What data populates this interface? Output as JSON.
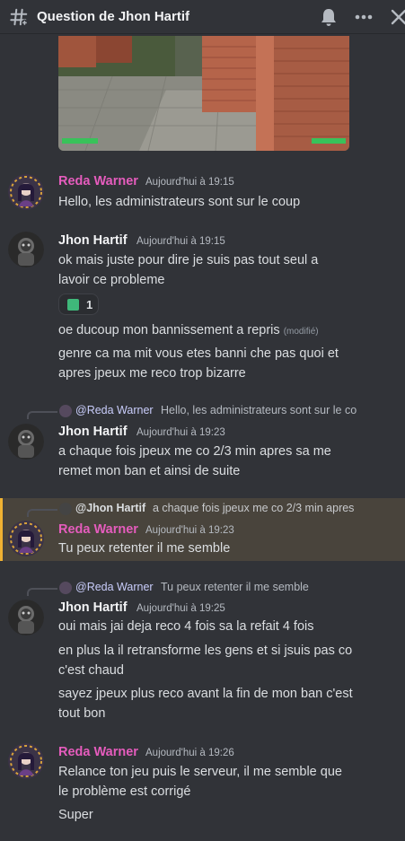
{
  "header": {
    "title": "Question de Jhon Hartif",
    "icons": [
      "hashtag-thread-icon",
      "bell-icon",
      "more-icon",
      "close-icon"
    ]
  },
  "messages": [
    {
      "author": "Reda Warner",
      "timestamp": "Aujourd'hui à 19:15",
      "lines": [
        "Hello, les administrateurs sont sur le coup"
      ]
    },
    {
      "author": "Jhon Hartif",
      "timestamp": "Aujourd'hui à 19:15",
      "lines": [
        "ok mais juste pour dire je suis pas tout seul a",
        "lavoir ce probleme"
      ],
      "reaction": {
        "count": "1"
      },
      "followups": [
        {
          "text": "oe ducoup mon bannissement a repris",
          "edited": "(modifié)"
        },
        {
          "text": "genre ca ma mit vous etes banni che pas quoi et"
        },
        {
          "text": "apres jpeux me reco trop bizarre"
        }
      ]
    },
    {
      "reply": {
        "mention": "@Reda Warner",
        "text": "Hello, les administrateurs sont sur le co"
      },
      "author": "Jhon Hartif",
      "timestamp": "Aujourd'hui à 19:23",
      "lines": [
        "a chaque fois jpeux me co 2/3 min apres sa me",
        "remet mon ban et ainsi de suite"
      ]
    },
    {
      "reply": {
        "mention": "@Jhon Hartif",
        "text": "a chaque fois jpeux me co 2/3 min apres"
      },
      "author": "Reda Warner",
      "timestamp": "Aujourd'hui à 19:23",
      "lines": [
        "Tu peux retenter il me semble"
      ]
    },
    {
      "reply": {
        "mention": "@Reda Warner",
        "text": "Tu peux retenter il me semble"
      },
      "author": "Jhon Hartif",
      "timestamp": "Aujourd'hui à 19:25",
      "lines": [
        "oui mais jai deja reco 4 fois sa la refait 4 fois",
        "en plus la il retransforme les gens et si jsuis pas co",
        "c'est chaud",
        "sayez jpeux plus reco avant la fin de mon ban c'est",
        "tout bon"
      ]
    },
    {
      "author": "Reda Warner",
      "timestamp": "Aujourd'hui à 19:26",
      "lines": [
        "Relance ton jeu puis le serveur, il me semble que",
        "le problème est corrigé",
        "Super"
      ]
    }
  ],
  "colors": {
    "background": "#313338",
    "reda": "#e55cbd",
    "mention": "#c9cdfb",
    "highlight": "#49443c"
  }
}
